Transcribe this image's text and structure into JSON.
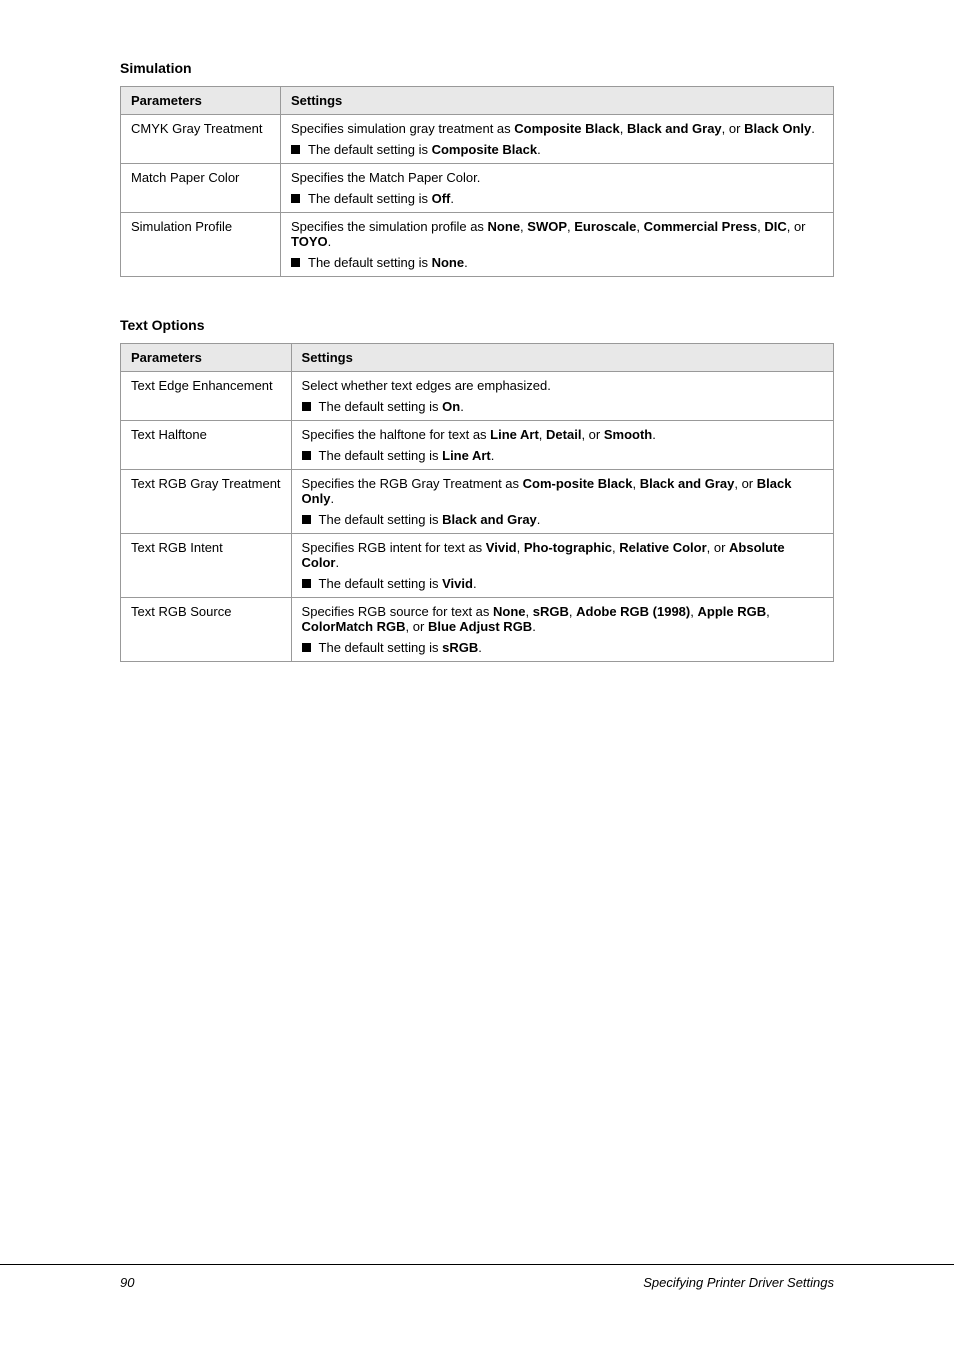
{
  "simulation_section": {
    "title": "Simulation",
    "table": {
      "col1_header": "Parameters",
      "col2_header": "Settings",
      "rows": [
        {
          "param": "CMYK Gray Treatment",
          "description_parts": [
            {
              "text": "Specifies simulation gray treatment as ",
              "bold": false
            },
            {
              "text": "Com-posite Black",
              "bold": true
            },
            {
              "text": ", ",
              "bold": false
            },
            {
              "text": "Black and Gray",
              "bold": true
            },
            {
              "text": ", or ",
              "bold": false
            },
            {
              "text": "Black Only",
              "bold": true
            },
            {
              "text": ".",
              "bold": false
            }
          ],
          "description_text": "Specifies simulation gray treatment as Com-posite Black, Black and Gray, or Black Only.",
          "bullet": "The default setting is Composite Black.",
          "bullet_bold": "Composite Black"
        },
        {
          "param": "Match Paper Color",
          "description_text": "Specifies the Match Paper Color.",
          "bullet": "The default setting is Off.",
          "bullet_bold": "Off"
        },
        {
          "param": "Simulation Profile",
          "description_text": "Specifies the simulation profile as None, SWOP, Euroscale, Commercial Press, DIC, or TOYO.",
          "bullet": "The default setting is None.",
          "bullet_bold": "None",
          "description_bold_parts": [
            "None",
            "SWOP",
            "Euroscale",
            "Commercial Press",
            "DIC",
            "TOYO"
          ]
        }
      ]
    }
  },
  "text_options_section": {
    "title": "Text Options",
    "table": {
      "col1_header": "Parameters",
      "col2_header": "Settings",
      "rows": [
        {
          "param": "Text Edge Enhancement",
          "description_text": "Select whether text edges are emphasized.",
          "bullet": "The default setting is On.",
          "bullet_bold": "On"
        },
        {
          "param": "Text Halftone",
          "description_text": "Specifies the halftone for text as Line Art, Detail, or Smooth.",
          "bullet": "The default setting is Line Art.",
          "bullet_bold": "Line Art",
          "description_bold_parts": [
            "Line Art",
            "Detail",
            "Smooth"
          ]
        },
        {
          "param": "Text RGB Gray Treatment",
          "description_text": "Specifies the RGB Gray Treatment as Com-posite Black, Black and Gray, or Black Only.",
          "bullet": "The default setting is Black and Gray.",
          "bullet_bold": "Black and Gray",
          "description_bold_parts": [
            "Com-posite Black",
            "Black and Gray",
            "Black Only"
          ]
        },
        {
          "param": "Text RGB Intent",
          "description_text": "Specifies RGB intent for text as Vivid, Pho-tographic, Relative Color, or Absolute Color.",
          "bullet": "The default setting is Vivid.",
          "bullet_bold": "Vivid",
          "description_bold_parts": [
            "Vivid",
            "Pho-tographic",
            "Relative Color",
            "Absolute Color"
          ]
        },
        {
          "param": "Text RGB Source",
          "description_text": "Specifies RGB source for text as None, sRGB, Adobe RGB (1998), Apple RGB, ColorMatch RGB, or Blue Adjust RGB.",
          "bullet": "The default setting is sRGB.",
          "bullet_bold": "sRGB",
          "description_bold_parts": [
            "None",
            "sRGB",
            "Adobe RGB (1998)",
            "Apple RGB",
            "ColorMatch RGB",
            "Blue Adjust RGB"
          ]
        }
      ]
    }
  },
  "footer": {
    "page_number": "90",
    "title": "Specifying Printer Driver Settings"
  }
}
